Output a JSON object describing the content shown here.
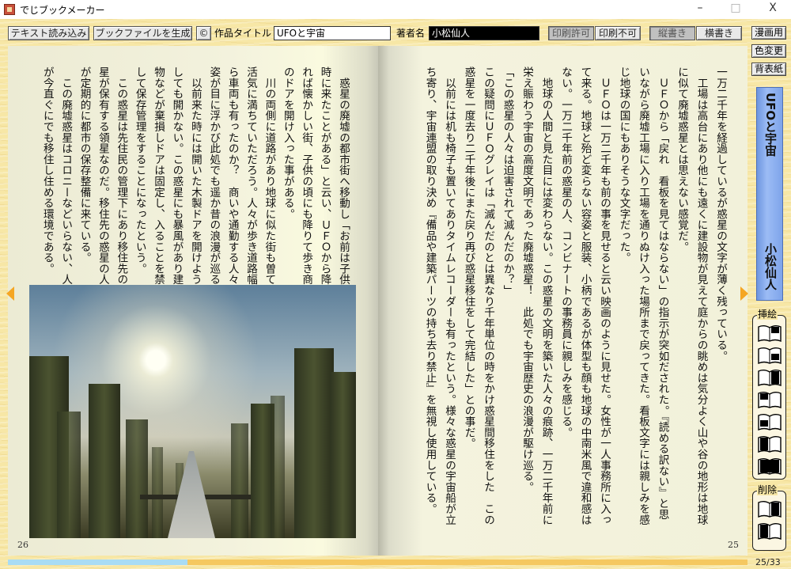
{
  "window": {
    "title": "でじブックメーカー",
    "minimize": "–",
    "maximize": "□",
    "close": "X"
  },
  "toolbar": {
    "load_text": "テキスト読み込み",
    "generate_book": "ブックファイルを生成",
    "copyright": "©",
    "title_label": "作品タイトル",
    "title_value": "UFOと宇宙",
    "author_label": "著者名",
    "author_value": "小松仙人",
    "print_allow": "印刷許可",
    "print_deny": "印刷不可",
    "vertical": "縦書き",
    "horizontal": "横書き"
  },
  "sidebar": {
    "manga": "漫画用",
    "color_change": "色変更",
    "back_cover": "背表紙",
    "spine_title": "UFOと宇宙",
    "spine_author": "小松仙人",
    "insert_group": "挿絵",
    "delete_group": "削除",
    "insert_icons": [
      "insert-right-top-icon",
      "insert-right-middle-icon",
      "insert-right-full-icon",
      "insert-left-top-icon",
      "insert-left-middle-icon",
      "insert-left-full-icon",
      "insert-spread-icon"
    ],
    "delete_icons": [
      "delete-right-icon",
      "delete-left-icon"
    ]
  },
  "colors": {
    "accent_blue": "#9cbcf5",
    "progress_read": "#f5c860",
    "progress_unread": "#a9dcf4",
    "arrow": "#f5a623"
  },
  "right_page": {
    "number": "25",
    "columns": [
      "一万二千年を経過しているが惑星の文字が薄く残っている。",
      "　工場は高台にあり他にも遠くに建設物が見えて庭からの眺めは気分よく山や谷の地形は地球",
      "に似て廃墟惑星とは思えない感覚だ。",
      "　ＵＦＯから「戻れ　看板を見てはならない」の指示が突如だされた。『読める訳ない』と思",
      "いながら廃墟工場に入り工場を通りぬけ入った場所まで戻ってきた。看板文字には親しみを感",
      "じ地球の国にもありそうな文字だった。",
      "　ＵＦＯは一万二千年も前の事を見せると云い映画のように見せた。女性が一人事務所に入っ",
      "て来る。地球と殆ど変らない容姿と服装、小柄であるが体型も顔も地球の中南米風で違和感は",
      "ない。一万二千年前の惑星の人、コンビナートの事務員に親しみを感じる。",
      "　地球の人間と見た目には変わらない。この惑星の文明を築いた人々の痕跡、一万二千年前に",
      "栄え賑わう宇宙の高度文明であった廃墟惑星！　此処でも宇宙歴史の浪漫が駆け巡る。",
      "「この惑星の人々は迫害されて滅んだのか？」",
      "この疑問にＵＦＯグレイは「滅んだのとは異なり千年単位の時をかけ惑星間移住をした　この",
      "惑星を一度去り二千年後にまた戻り再び惑星移住をして完結した」との事だ。",
      "　以前には机も椅子も置いてありタイムレコーダーも有ったという。様々な惑星の宇宙船が立",
      "ち寄り、宇宙連盟の取り決め『備品や建築パーツの持ち去り禁止』を無視し使用している。"
    ]
  },
  "left_page": {
    "number": "26",
    "columns": [
      "　惑星の廃墟の都市街へ移動し「お前は子供の",
      "時に来たことがある」と云い、ＵＦＯから降り",
      "れば懐かしい街、子供の頃にも降りて歩き商店",
      "のドアを開け入った事がある。",
      "　川の両側に道路があり地球に似た街も曽ては",
      "活気に満ちていただろう。人々が歩き道路幅か",
      "ら車両も有ったのか？　商いや通勤する人々の",
      "姿が目に浮かび此処でも遥か昔の浪漫が巡る。",
      "　以前来た時には開いた木製ドアを開けようと",
      "しても開かない。この惑星にも暴風があり建築",
      "物などが棄損しドアは固定し、入ることを禁止",
      "して保存管理をすることになったという。",
      "　この惑星は先住民の管理下にあり移住先の惑",
      "星が保有する領星なのだ。移住先の惑星の人々",
      "が定期的に都市の保存整備に来ている。",
      "　この廃墟惑星はコロニーなどいらない、人間",
      "が今直ぐにでも移住し住める環境である。"
    ]
  },
  "navigation": {
    "current_page": 25,
    "total_pages": 33,
    "counter": "25/33"
  }
}
